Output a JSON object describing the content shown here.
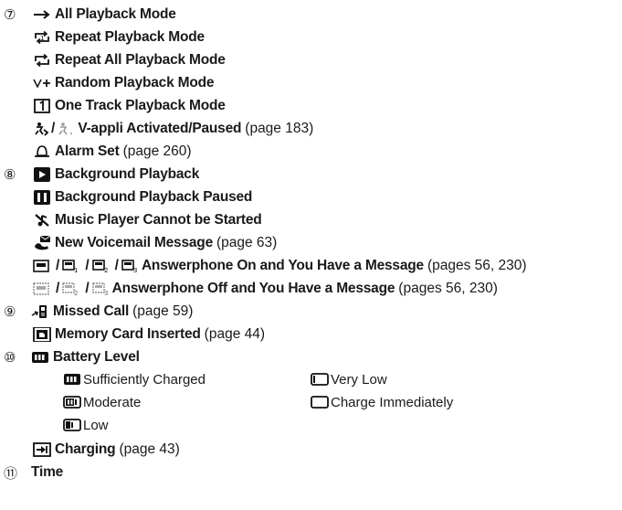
{
  "markers": {
    "m7": "⑦",
    "m8": "⑧",
    "m9": "⑨",
    "m10": "⑩",
    "m11": "⑪"
  },
  "items": {
    "all_playback": "All Playback Mode",
    "repeat_playback": "Repeat Playback Mode",
    "repeat_all_playback": "Repeat All Playback Mode",
    "random_playback": "Random Playback Mode",
    "one_track_playback": "One Track Playback Mode",
    "vappli": "V-appli Activated/Paused",
    "vappli_ref": "(page 183)",
    "alarm": "Alarm Set",
    "alarm_ref": "(page 260)",
    "background_playback": "Background Playback",
    "background_paused": "Background Playback Paused",
    "music_cannot_start": "Music Player Cannot be Started",
    "voicemail": "New Voicemail Message",
    "voicemail_ref": "(page 63)",
    "answer_on": "Answerphone On and You Have a Message",
    "answer_on_ref": "(pages 56, 230)",
    "answer_off": "Answerphone Off and You Have a Message",
    "answer_off_ref": "(pages 56, 230)",
    "missed_call": "Missed Call",
    "missed_call_ref": "(page 59)",
    "memory_card": "Memory Card Inserted",
    "memory_card_ref": "(page 44)",
    "battery_level": "Battery Level",
    "battery_sufficient": "Sufficiently Charged",
    "battery_very_low": "Very Low",
    "battery_moderate": "Moderate",
    "battery_charge_immediately": "Charge Immediately",
    "battery_low": "Low",
    "charging": "Charging",
    "charging_ref": "(page 43)",
    "time": "Time"
  },
  "separator": "/",
  "icons": [
    "arrow-right-icon",
    "repeat-one-icon",
    "repeat-all-icon",
    "random-icon",
    "one-track-icon",
    "vappli-icon",
    "alarm-bell-icon",
    "play-icon",
    "pause-icon",
    "music-blocked-icon",
    "voicemail-icon",
    "answerphone-on-icon",
    "answerphone-off-icon",
    "missed-call-icon",
    "memory-card-icon",
    "battery-icon",
    "charging-icon"
  ]
}
